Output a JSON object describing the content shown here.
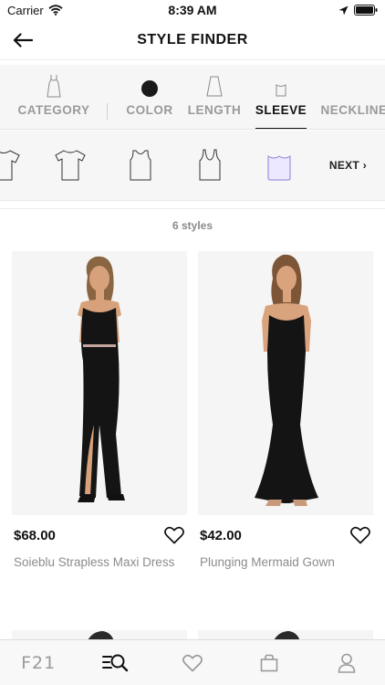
{
  "status_bar": {
    "carrier": "Carrier",
    "time": "8:39 AM"
  },
  "header": {
    "title": "STYLE FINDER"
  },
  "filter_tabs": [
    {
      "label": "CATEGORY",
      "active": false
    },
    {
      "label": "COLOR",
      "active": false
    },
    {
      "label": "LENGTH",
      "active": false
    },
    {
      "label": "SLEEVE",
      "active": true
    },
    {
      "label": "NECKLINE",
      "active": false
    }
  ],
  "sleeve_options": {
    "items": [
      "short-sleeve",
      "tee",
      "sleeveless",
      "tank",
      "strapless"
    ],
    "selected": "strapless",
    "next_label": "NEXT ›"
  },
  "results": {
    "count_label": "6 styles"
  },
  "products": [
    {
      "price": "$68.00",
      "name": "Soieblu Strapless Maxi Dress"
    },
    {
      "price": "$42.00",
      "name": "Plunging Mermaid Gown"
    }
  ],
  "bottom_nav": {
    "brand": "F21"
  },
  "colors": {
    "accent": "#111111",
    "muted": "#9a9a9a",
    "selected_sleeve": "#ece8ff"
  }
}
